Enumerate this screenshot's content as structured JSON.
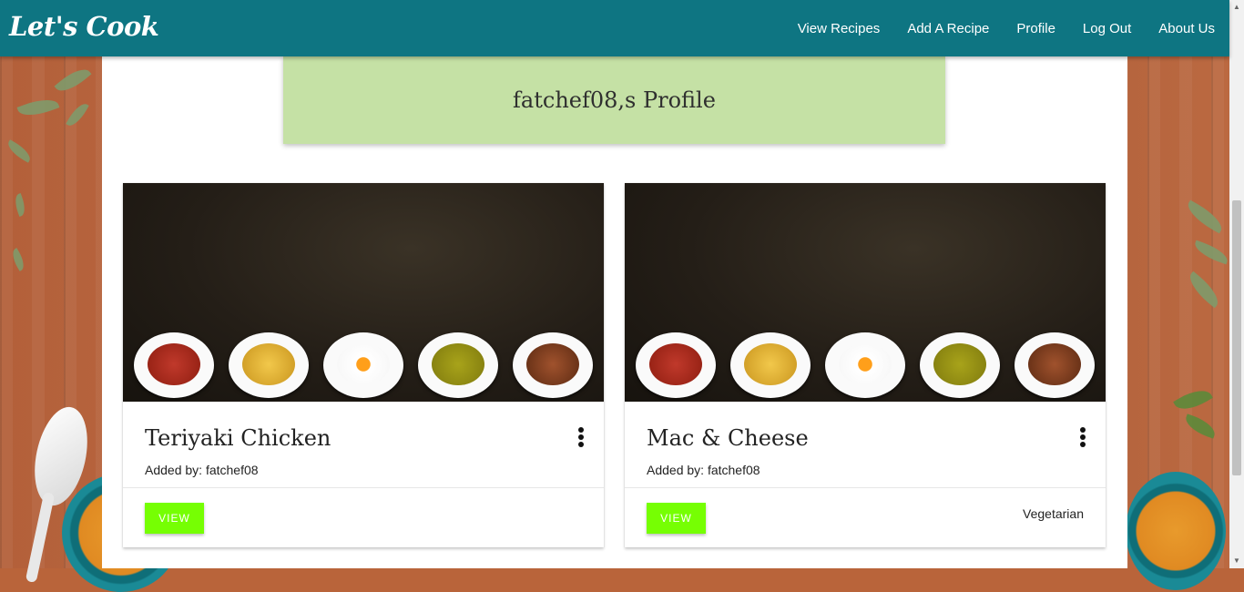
{
  "brand": "Let's Cook",
  "nav": {
    "view_recipes": "View Recipes",
    "add_recipe": "Add A Recipe",
    "profile": "Profile",
    "logout": "Log Out",
    "about": "About Us"
  },
  "profile": {
    "title": "fatchef08,s Profile"
  },
  "recipes": [
    {
      "title": "Teriyaki Chicken",
      "added_by": "Added by: fatchef08",
      "view_label": "VIEW",
      "tag": ""
    },
    {
      "title": "Mac & Cheese",
      "added_by": "Added by: fatchef08",
      "view_label": "VIEW",
      "tag": "Vegetarian"
    }
  ],
  "icons": {
    "more": "more-vert-icon",
    "scroll_up": "chevron-up-icon",
    "scroll_down": "chevron-down-icon"
  },
  "colors": {
    "navbar": "#0e7582",
    "banner": "#c5e1a5",
    "view_button": "#76ff03"
  }
}
